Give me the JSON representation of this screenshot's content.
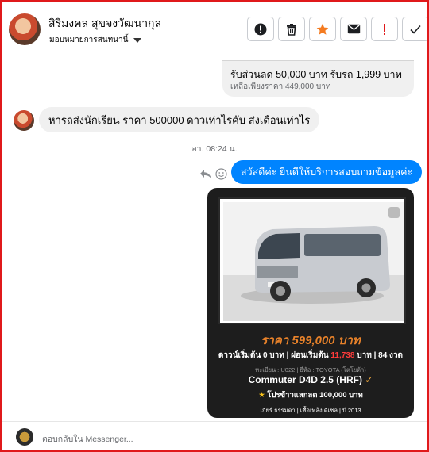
{
  "header": {
    "contact_name": "สิริมงคล สุขจงวัฒนากุล",
    "assign_label": "มอบหมายการสนทนานี้",
    "actions": [
      {
        "icon": "exclamation-circle-icon",
        "glyph": "!"
      },
      {
        "icon": "trash-icon",
        "glyph": "🗑"
      },
      {
        "icon": "star-icon",
        "glyph": "★",
        "color": "#f47b20"
      },
      {
        "icon": "mail-icon",
        "glyph": "✉"
      },
      {
        "icon": "exclamation-red-icon",
        "glyph": "!",
        "color": "#e0191b"
      },
      {
        "icon": "check-icon",
        "glyph": "✓"
      }
    ]
  },
  "conversation": {
    "prev_card": {
      "title": "รับส่วนลด 50,000 บาท รับรถ 1,999 บาท",
      "subtitle": "เหลือเพียงราคา 449,000 บาท"
    },
    "incoming_message": "หารถส่งนักเรียน ราคา 500000 ดาวเท่าไรคับ ส่งเดือนเท่าไร",
    "timestamp": "อา. 08:24 น.",
    "outgoing_message": "สวัสดีค่ะ ยินดีให้บริการสอบถามข้อมูลค่ะ",
    "ad": {
      "price": "ราคา 599,000 บาท",
      "down_payment_prefix": "ดาวน์เริ่มต้น 0 บาท | ผ่อนเริ่มต้น",
      "installment": "11,738",
      "installment_suffix": "บาท | 84 งวด",
      "meta": "ทะเบียน : U022 | ยี่ห้อ : TOYOTA (โตโยต้า)",
      "model": "Commuter D4D 2.5 (HRF)",
      "promo": "โปรข้าวแลกลด 100,000 บาท",
      "specs": "เกียร์ ธรรมดา  |  เชื้อเพลิง ดีเซล  |  ปี 2013"
    },
    "colors": {
      "outgoing_bubble": "#0084ff",
      "incoming_bubble": "#f0f0f0",
      "price": "#e8822a",
      "border": "#e0191b"
    }
  },
  "footer": {
    "reply_placeholder": "ตอบกลับใน Messenger..."
  }
}
